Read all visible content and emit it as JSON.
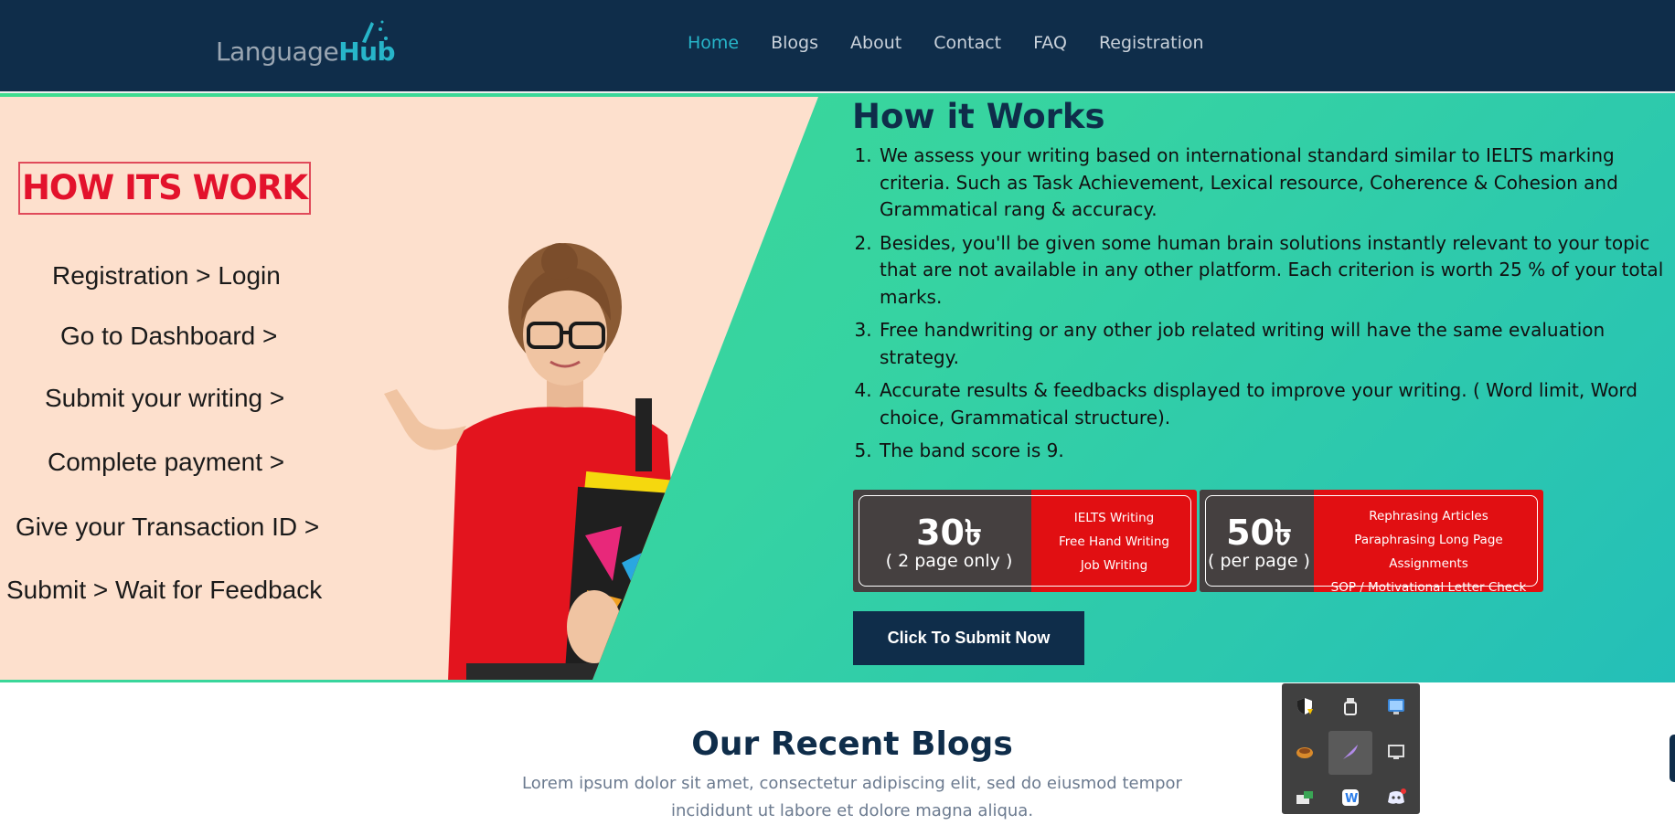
{
  "header": {
    "logo_prefix": "Language",
    "logo_suffix": "Hub",
    "nav": [
      {
        "label": "Home",
        "active": true
      },
      {
        "label": "Blogs",
        "active": false
      },
      {
        "label": "About",
        "active": false
      },
      {
        "label": "Contact",
        "active": false
      },
      {
        "label": "FAQ",
        "active": false
      },
      {
        "label": "Registration",
        "active": false
      }
    ]
  },
  "poster": {
    "title": "HOW ITS WORK",
    "steps": [
      "Registration > Login",
      "Go to Dashboard >",
      "Submit your writing >",
      "Complete payment >",
      "Give your Transaction ID >",
      "Submit > Wait for Feedback"
    ]
  },
  "how_it_works": {
    "title": "How it Works",
    "items": [
      "We assess your writing based on international standard similar to IELTS marking criteria. Such as Task Achievement, Lexical resource, Coherence & Cohesion and Grammatical rang & accuracy.",
      "Besides, you'll be given some human brain solutions instantly relevant to your topic that are not available in any other platform. Each criterion is worth 25 % of your total marks.",
      "Free handwriting or any other job related writing will have the same evaluation strategy.",
      "Accurate results & feedbacks displayed to improve your writing. ( Word limit, Word choice, Grammatical structure).",
      "The band score is 9."
    ]
  },
  "pricing": [
    {
      "amount": "30৳",
      "note": "( 2 page only )",
      "features": [
        "IELTS Writing",
        "Free Hand Writing",
        "Job Writing"
      ]
    },
    {
      "amount": "50৳",
      "note": "( per page )",
      "features": [
        "Rephrasing Articles",
        "Paraphrasing Long Page Assignments",
        "SOP / Motivational Letter Check"
      ]
    }
  ],
  "cta": {
    "label": "Click To Submit Now"
  },
  "blogs": {
    "title": "Our Recent Blogs",
    "subtitle": "Lorem ipsum dolor sit amet, consectetur adipiscing elit, sed do eiusmod tempor incididunt ut labore et dolore magna aliqua."
  },
  "colors": {
    "header_bg": "#0f2d4a",
    "accent": "#27b5c9",
    "hero_green": "#3fdc8e",
    "hero_teal": "#24bfb8",
    "price_red": "#e10f12",
    "poster_bg": "#fde0cd"
  },
  "tray_icons": [
    "security-shield-icon",
    "usb-drive-icon",
    "network-monitor-icon",
    "app-orange-icon",
    "feather-pen-icon",
    "display-icon",
    "device-manager-icon",
    "wps-office-icon",
    "discord-icon"
  ]
}
